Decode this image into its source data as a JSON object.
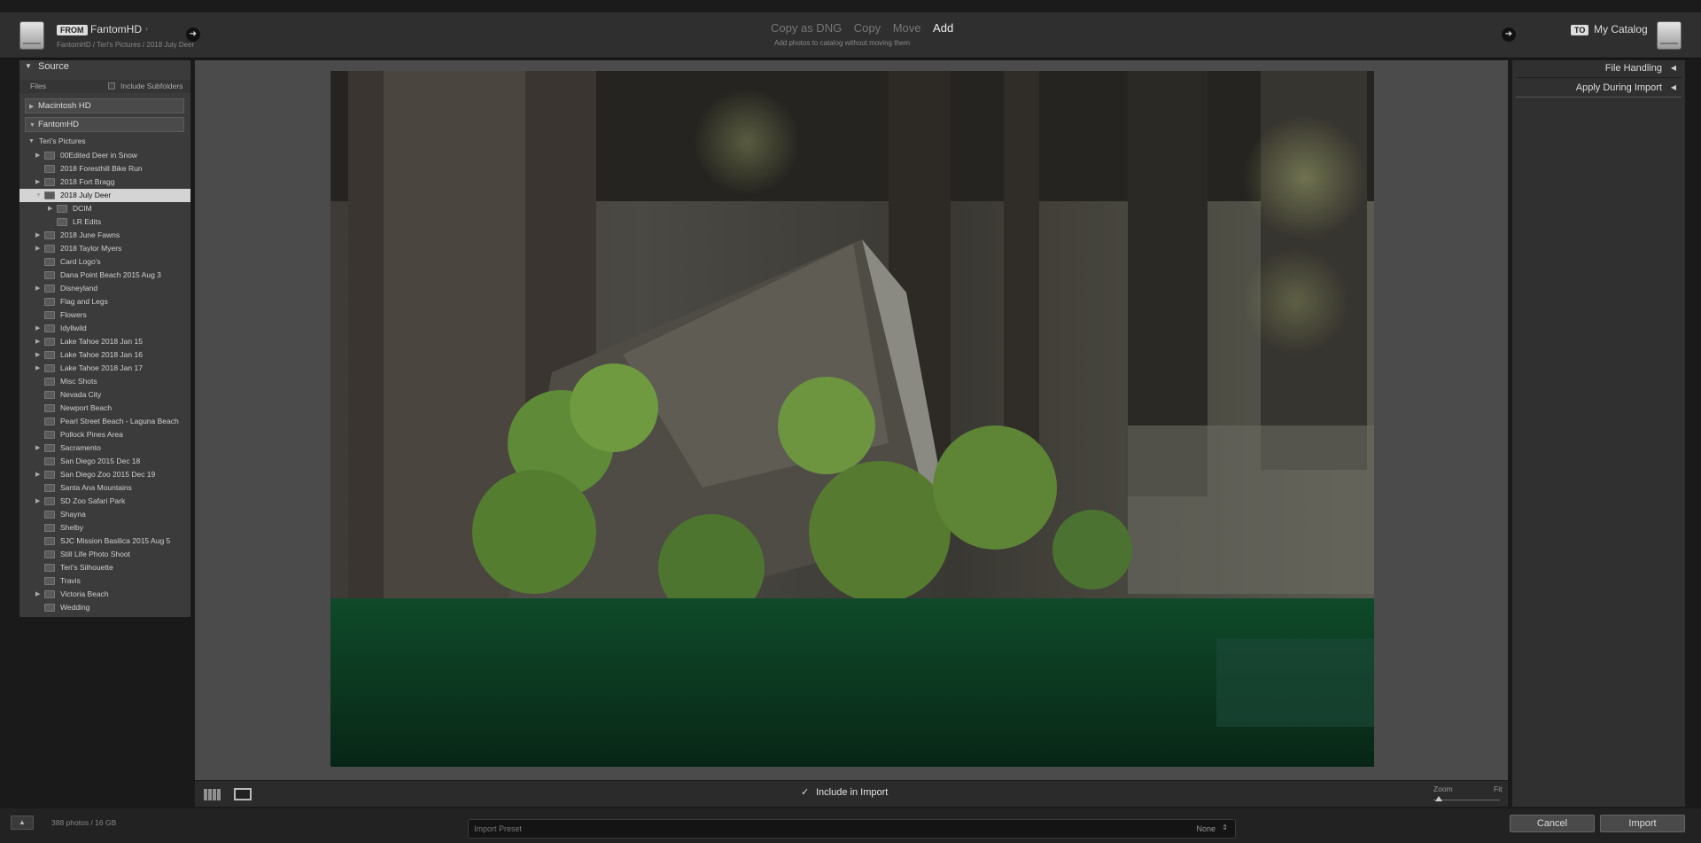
{
  "header": {
    "from_tag": "FROM",
    "from_drive": "FantomHD",
    "from_path": "FantomHD / Teri's Pictures / 2018 July Deer",
    "modes": [
      "Copy as DNG",
      "Copy",
      "Move",
      "Add"
    ],
    "active_mode": "Add",
    "mode_hint": "Add photos to catalog without moving them",
    "to_tag": "TO",
    "to_catalog": "My Catalog"
  },
  "source": {
    "title": "Source",
    "files_label": "Files",
    "include_subfolders_label": "Include Subfolders",
    "drives": [
      "Macintosh HD",
      "FantomHD"
    ],
    "root_folder": "Teri's Pictures",
    "folders": [
      {
        "label": "00Edited Deer in Snow",
        "expander": "right"
      },
      {
        "label": "2018 Foresthill Bike Run",
        "expander": "none"
      },
      {
        "label": "2018 Fort Bragg",
        "expander": "right"
      },
      {
        "label": "2018 July Deer",
        "expander": "down",
        "selected": true
      },
      {
        "label": "DCIM",
        "expander": "right",
        "child": true
      },
      {
        "label": "LR Edits",
        "expander": "none",
        "child": true
      },
      {
        "label": "2018 June Fawns",
        "expander": "right"
      },
      {
        "label": "2018 Taylor Myers",
        "expander": "right"
      },
      {
        "label": "Card Logo's",
        "expander": "none"
      },
      {
        "label": "Dana Point Beach 2015 Aug 3",
        "expander": "none"
      },
      {
        "label": "Disneyland",
        "expander": "right"
      },
      {
        "label": "Flag and Legs",
        "expander": "none"
      },
      {
        "label": "Flowers",
        "expander": "none"
      },
      {
        "label": "Idyllwild",
        "expander": "right"
      },
      {
        "label": "Lake Tahoe 2018 Jan 15",
        "expander": "right"
      },
      {
        "label": "Lake Tahoe 2018 Jan 16",
        "expander": "right"
      },
      {
        "label": "Lake Tahoe 2018 Jan 17",
        "expander": "right"
      },
      {
        "label": "Misc Shots",
        "expander": "none"
      },
      {
        "label": "Nevada City",
        "expander": "none"
      },
      {
        "label": "Newport Beach",
        "expander": "none"
      },
      {
        "label": "Pearl Street Beach - Laguna Beach",
        "expander": "none"
      },
      {
        "label": "Pollock Pines Area",
        "expander": "none"
      },
      {
        "label": "Sacramento",
        "expander": "right"
      },
      {
        "label": "San Diego 2015 Dec 18",
        "expander": "none"
      },
      {
        "label": "San Diego Zoo 2015 Dec 19",
        "expander": "right"
      },
      {
        "label": "Santa Ana Mountains",
        "expander": "none"
      },
      {
        "label": "SD Zoo Safari Park",
        "expander": "right"
      },
      {
        "label": "Shayna",
        "expander": "none"
      },
      {
        "label": "Shelby",
        "expander": "none"
      },
      {
        "label": "SJC Mission Basilica 2015 Aug 5",
        "expander": "none"
      },
      {
        "label": "Still Life Photo Shoot",
        "expander": "none"
      },
      {
        "label": "Teri's Silhouette",
        "expander": "none"
      },
      {
        "label": "Travis",
        "expander": "none"
      },
      {
        "label": "Victoria Beach",
        "expander": "right"
      },
      {
        "label": "Wedding",
        "expander": "none"
      }
    ]
  },
  "right_panel": {
    "sections": [
      "File Handling",
      "Apply During Import"
    ]
  },
  "toolbar": {
    "include_label": "Include in Import",
    "include_checked": true,
    "zoom_label": "Zoom",
    "zoom_fit": "Fit"
  },
  "footer": {
    "status": "388 photos / 16 GB",
    "preset_label": "Import Preset",
    "preset_value": "None",
    "cancel_label": "Cancel",
    "import_label": "Import"
  },
  "colors": {
    "selected_row": "#d4d4d4",
    "panel_bg": "#3b3b3b",
    "center_bg": "#4b4b4b"
  },
  "icons": [
    "drive-icon",
    "arrow-right-icon",
    "grid-view-icon",
    "loupe-view-icon",
    "checkmark-icon",
    "collapse-arrow-icon"
  ]
}
